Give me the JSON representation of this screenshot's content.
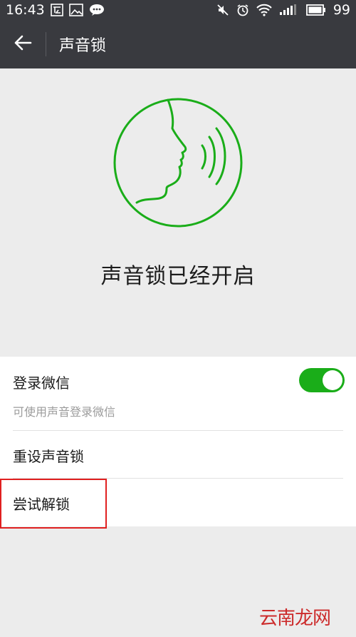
{
  "statusbar": {
    "time": "16:43",
    "battery": "99",
    "left_icons": [
      "app-notification-icon",
      "image-icon",
      "wechat-icon"
    ],
    "right_icons": [
      "mute-icon",
      "alarm-icon",
      "wifi-icon",
      "signal-icon",
      "battery-icon"
    ]
  },
  "titlebar": {
    "title": "声音锁",
    "back_icon": "back-arrow-icon"
  },
  "hero": {
    "icon": "voice-face-icon",
    "status_text": "声音锁已经开启"
  },
  "settings": {
    "login": {
      "label": "登录微信",
      "sublabel": "可使用声音登录微信",
      "toggle_on": true
    },
    "reset": {
      "label": "重设声音锁"
    },
    "try_unlock": {
      "label": "尝试解锁"
    }
  },
  "watermark": {
    "text": "云南龙网"
  },
  "colors": {
    "accent": "#1aad19",
    "topbar": "#393a3f",
    "highlight": "#e02020",
    "background": "#ececec"
  }
}
